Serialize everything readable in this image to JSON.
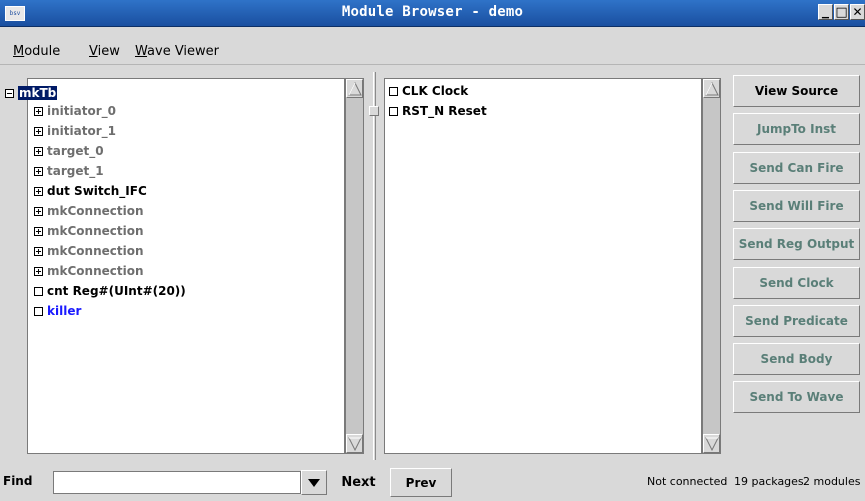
{
  "window": {
    "icon_text": "bsv",
    "title": "Module Browser - demo",
    "controls": {
      "minimize": "▁",
      "maximize": "□",
      "close": "✕"
    }
  },
  "menu": [
    {
      "label": "Module",
      "underline": "M",
      "rest": "odule"
    },
    {
      "label": "View",
      "underline": "V",
      "rest": "iew"
    },
    {
      "label": "Wave Viewer",
      "underline": "W",
      "rest": "ave Viewer"
    }
  ],
  "tree": {
    "root": {
      "label": "mkTb",
      "selected": true
    },
    "items": [
      {
        "label": "initiator_0",
        "expander": "plus",
        "style": "gray"
      },
      {
        "label": "initiator_1",
        "expander": "plus",
        "style": "gray"
      },
      {
        "label": "target_0",
        "expander": "plus",
        "style": "gray"
      },
      {
        "label": "target_1",
        "expander": "plus",
        "style": "gray"
      },
      {
        "label": "dut  Switch_IFC",
        "expander": "plus",
        "style": "black"
      },
      {
        "label": "mkConnection",
        "expander": "plus",
        "style": "gray"
      },
      {
        "label": "mkConnection",
        "expander": "plus",
        "style": "gray"
      },
      {
        "label": "mkConnection",
        "expander": "plus",
        "style": "gray"
      },
      {
        "label": "mkConnection",
        "expander": "plus",
        "style": "gray"
      },
      {
        "label": "cnt  Reg#(UInt#(20))",
        "expander": "leaf",
        "style": "black"
      },
      {
        "label": "killer",
        "expander": "leaf",
        "style": "blue"
      }
    ]
  },
  "signals": [
    {
      "label": "CLK  Clock"
    },
    {
      "label": "RST_N  Reset"
    }
  ],
  "buttons": [
    {
      "label": "View Source",
      "enabled": true
    },
    {
      "label": "JumpTo Inst",
      "enabled": false
    },
    {
      "label": "Send Can Fire",
      "enabled": false
    },
    {
      "label": "Send Will Fire",
      "enabled": false
    },
    {
      "label": "Send Reg Output",
      "enabled": false
    },
    {
      "label": "Send Clock",
      "enabled": false
    },
    {
      "label": "Send Predicate",
      "enabled": false
    },
    {
      "label": "Send Body",
      "enabled": false
    },
    {
      "label": "Send To Wave",
      "enabled": false
    }
  ],
  "find": {
    "label": "Find",
    "value": "",
    "next_label": "Next",
    "prev_label": "Prev"
  },
  "status": {
    "connection": "Not connected",
    "packages": "19 packages",
    "modules": "2 modules"
  }
}
